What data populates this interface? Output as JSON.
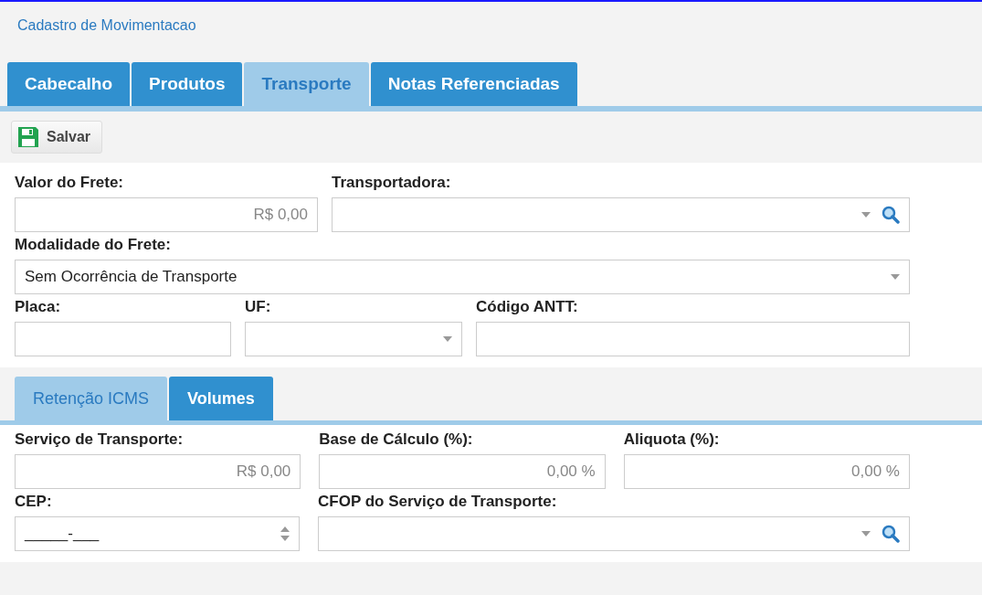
{
  "title": "Cadastro de Movimentacao",
  "tabs": [
    {
      "label": "Cabecalho",
      "selected": false
    },
    {
      "label": "Produtos",
      "selected": false
    },
    {
      "label": "Transporte",
      "selected": true
    },
    {
      "label": "Notas Referenciadas",
      "selected": false
    }
  ],
  "toolbar": {
    "save_label": "Salvar"
  },
  "form_rows": [
    [
      {
        "label": "Valor do Frete:",
        "kind": "text",
        "placeholder": "R$ 0,00"
      },
      {
        "label": "Transportadora:",
        "kind": "lookup"
      }
    ],
    [
      {
        "label": "Modalidade do Frete:",
        "kind": "select",
        "value": "Sem Ocorrência de Transporte"
      }
    ],
    [
      {
        "label": "Placa:",
        "kind": "text"
      },
      {
        "label": "UF:",
        "kind": "select"
      },
      {
        "label": "Código ANTT:",
        "kind": "text"
      }
    ]
  ],
  "subtabs": [
    {
      "label": "Retenção ICMS",
      "selected": true
    },
    {
      "label": "Volumes",
      "selected": false
    }
  ],
  "sub_rows": [
    [
      {
        "label": "Serviço de Transporte:",
        "kind": "text",
        "placeholder": "R$ 0,00"
      },
      {
        "label": "Base de Cálculo (%):",
        "kind": "text",
        "placeholder": "0,00 %"
      },
      {
        "label": "Aliquota (%):",
        "kind": "text",
        "placeholder": "0,00 %"
      }
    ],
    [
      {
        "label": "CEP:",
        "kind": "spinner",
        "value": "_____-___"
      },
      {
        "label": "CFOP do Serviço de Transporte:",
        "kind": "lookup"
      }
    ]
  ]
}
